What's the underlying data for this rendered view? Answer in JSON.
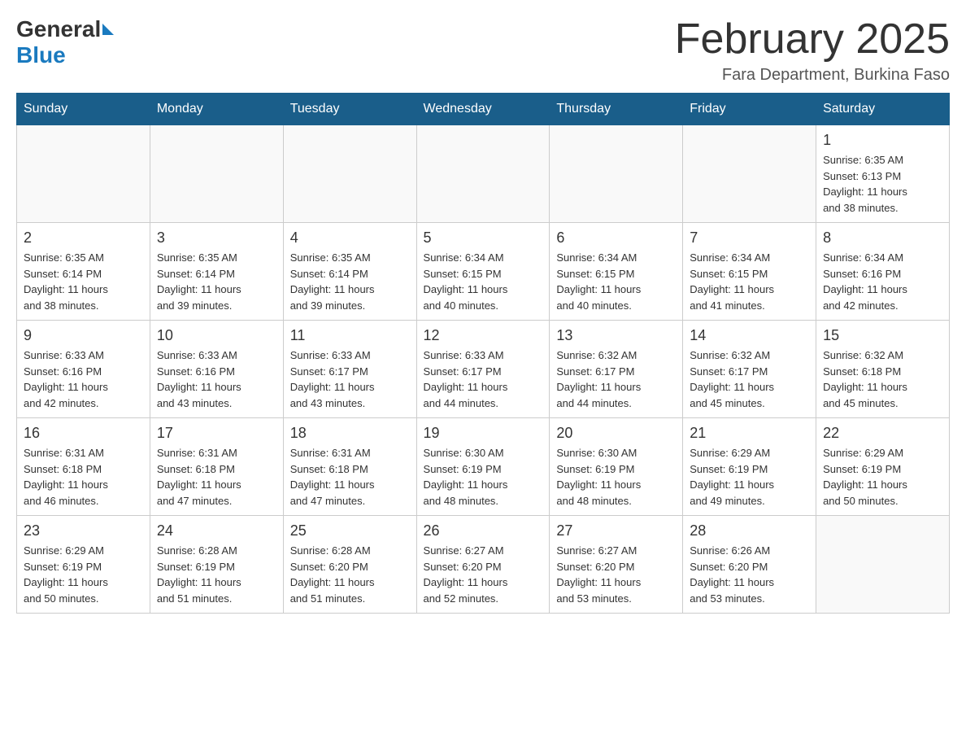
{
  "header": {
    "logo_general": "General",
    "logo_blue": "Blue",
    "month_title": "February 2025",
    "subtitle": "Fara Department, Burkina Faso"
  },
  "days_of_week": [
    "Sunday",
    "Monday",
    "Tuesday",
    "Wednesday",
    "Thursday",
    "Friday",
    "Saturday"
  ],
  "weeks": [
    [
      {
        "day": "",
        "info": ""
      },
      {
        "day": "",
        "info": ""
      },
      {
        "day": "",
        "info": ""
      },
      {
        "day": "",
        "info": ""
      },
      {
        "day": "",
        "info": ""
      },
      {
        "day": "",
        "info": ""
      },
      {
        "day": "1",
        "info": "Sunrise: 6:35 AM\nSunset: 6:13 PM\nDaylight: 11 hours\nand 38 minutes."
      }
    ],
    [
      {
        "day": "2",
        "info": "Sunrise: 6:35 AM\nSunset: 6:14 PM\nDaylight: 11 hours\nand 38 minutes."
      },
      {
        "day": "3",
        "info": "Sunrise: 6:35 AM\nSunset: 6:14 PM\nDaylight: 11 hours\nand 39 minutes."
      },
      {
        "day": "4",
        "info": "Sunrise: 6:35 AM\nSunset: 6:14 PM\nDaylight: 11 hours\nand 39 minutes."
      },
      {
        "day": "5",
        "info": "Sunrise: 6:34 AM\nSunset: 6:15 PM\nDaylight: 11 hours\nand 40 minutes."
      },
      {
        "day": "6",
        "info": "Sunrise: 6:34 AM\nSunset: 6:15 PM\nDaylight: 11 hours\nand 40 minutes."
      },
      {
        "day": "7",
        "info": "Sunrise: 6:34 AM\nSunset: 6:15 PM\nDaylight: 11 hours\nand 41 minutes."
      },
      {
        "day": "8",
        "info": "Sunrise: 6:34 AM\nSunset: 6:16 PM\nDaylight: 11 hours\nand 42 minutes."
      }
    ],
    [
      {
        "day": "9",
        "info": "Sunrise: 6:33 AM\nSunset: 6:16 PM\nDaylight: 11 hours\nand 42 minutes."
      },
      {
        "day": "10",
        "info": "Sunrise: 6:33 AM\nSunset: 6:16 PM\nDaylight: 11 hours\nand 43 minutes."
      },
      {
        "day": "11",
        "info": "Sunrise: 6:33 AM\nSunset: 6:17 PM\nDaylight: 11 hours\nand 43 minutes."
      },
      {
        "day": "12",
        "info": "Sunrise: 6:33 AM\nSunset: 6:17 PM\nDaylight: 11 hours\nand 44 minutes."
      },
      {
        "day": "13",
        "info": "Sunrise: 6:32 AM\nSunset: 6:17 PM\nDaylight: 11 hours\nand 44 minutes."
      },
      {
        "day": "14",
        "info": "Sunrise: 6:32 AM\nSunset: 6:17 PM\nDaylight: 11 hours\nand 45 minutes."
      },
      {
        "day": "15",
        "info": "Sunrise: 6:32 AM\nSunset: 6:18 PM\nDaylight: 11 hours\nand 45 minutes."
      }
    ],
    [
      {
        "day": "16",
        "info": "Sunrise: 6:31 AM\nSunset: 6:18 PM\nDaylight: 11 hours\nand 46 minutes."
      },
      {
        "day": "17",
        "info": "Sunrise: 6:31 AM\nSunset: 6:18 PM\nDaylight: 11 hours\nand 47 minutes."
      },
      {
        "day": "18",
        "info": "Sunrise: 6:31 AM\nSunset: 6:18 PM\nDaylight: 11 hours\nand 47 minutes."
      },
      {
        "day": "19",
        "info": "Sunrise: 6:30 AM\nSunset: 6:19 PM\nDaylight: 11 hours\nand 48 minutes."
      },
      {
        "day": "20",
        "info": "Sunrise: 6:30 AM\nSunset: 6:19 PM\nDaylight: 11 hours\nand 48 minutes."
      },
      {
        "day": "21",
        "info": "Sunrise: 6:29 AM\nSunset: 6:19 PM\nDaylight: 11 hours\nand 49 minutes."
      },
      {
        "day": "22",
        "info": "Sunrise: 6:29 AM\nSunset: 6:19 PM\nDaylight: 11 hours\nand 50 minutes."
      }
    ],
    [
      {
        "day": "23",
        "info": "Sunrise: 6:29 AM\nSunset: 6:19 PM\nDaylight: 11 hours\nand 50 minutes."
      },
      {
        "day": "24",
        "info": "Sunrise: 6:28 AM\nSunset: 6:19 PM\nDaylight: 11 hours\nand 51 minutes."
      },
      {
        "day": "25",
        "info": "Sunrise: 6:28 AM\nSunset: 6:20 PM\nDaylight: 11 hours\nand 51 minutes."
      },
      {
        "day": "26",
        "info": "Sunrise: 6:27 AM\nSunset: 6:20 PM\nDaylight: 11 hours\nand 52 minutes."
      },
      {
        "day": "27",
        "info": "Sunrise: 6:27 AM\nSunset: 6:20 PM\nDaylight: 11 hours\nand 53 minutes."
      },
      {
        "day": "28",
        "info": "Sunrise: 6:26 AM\nSunset: 6:20 PM\nDaylight: 11 hours\nand 53 minutes."
      },
      {
        "day": "",
        "info": ""
      }
    ]
  ]
}
